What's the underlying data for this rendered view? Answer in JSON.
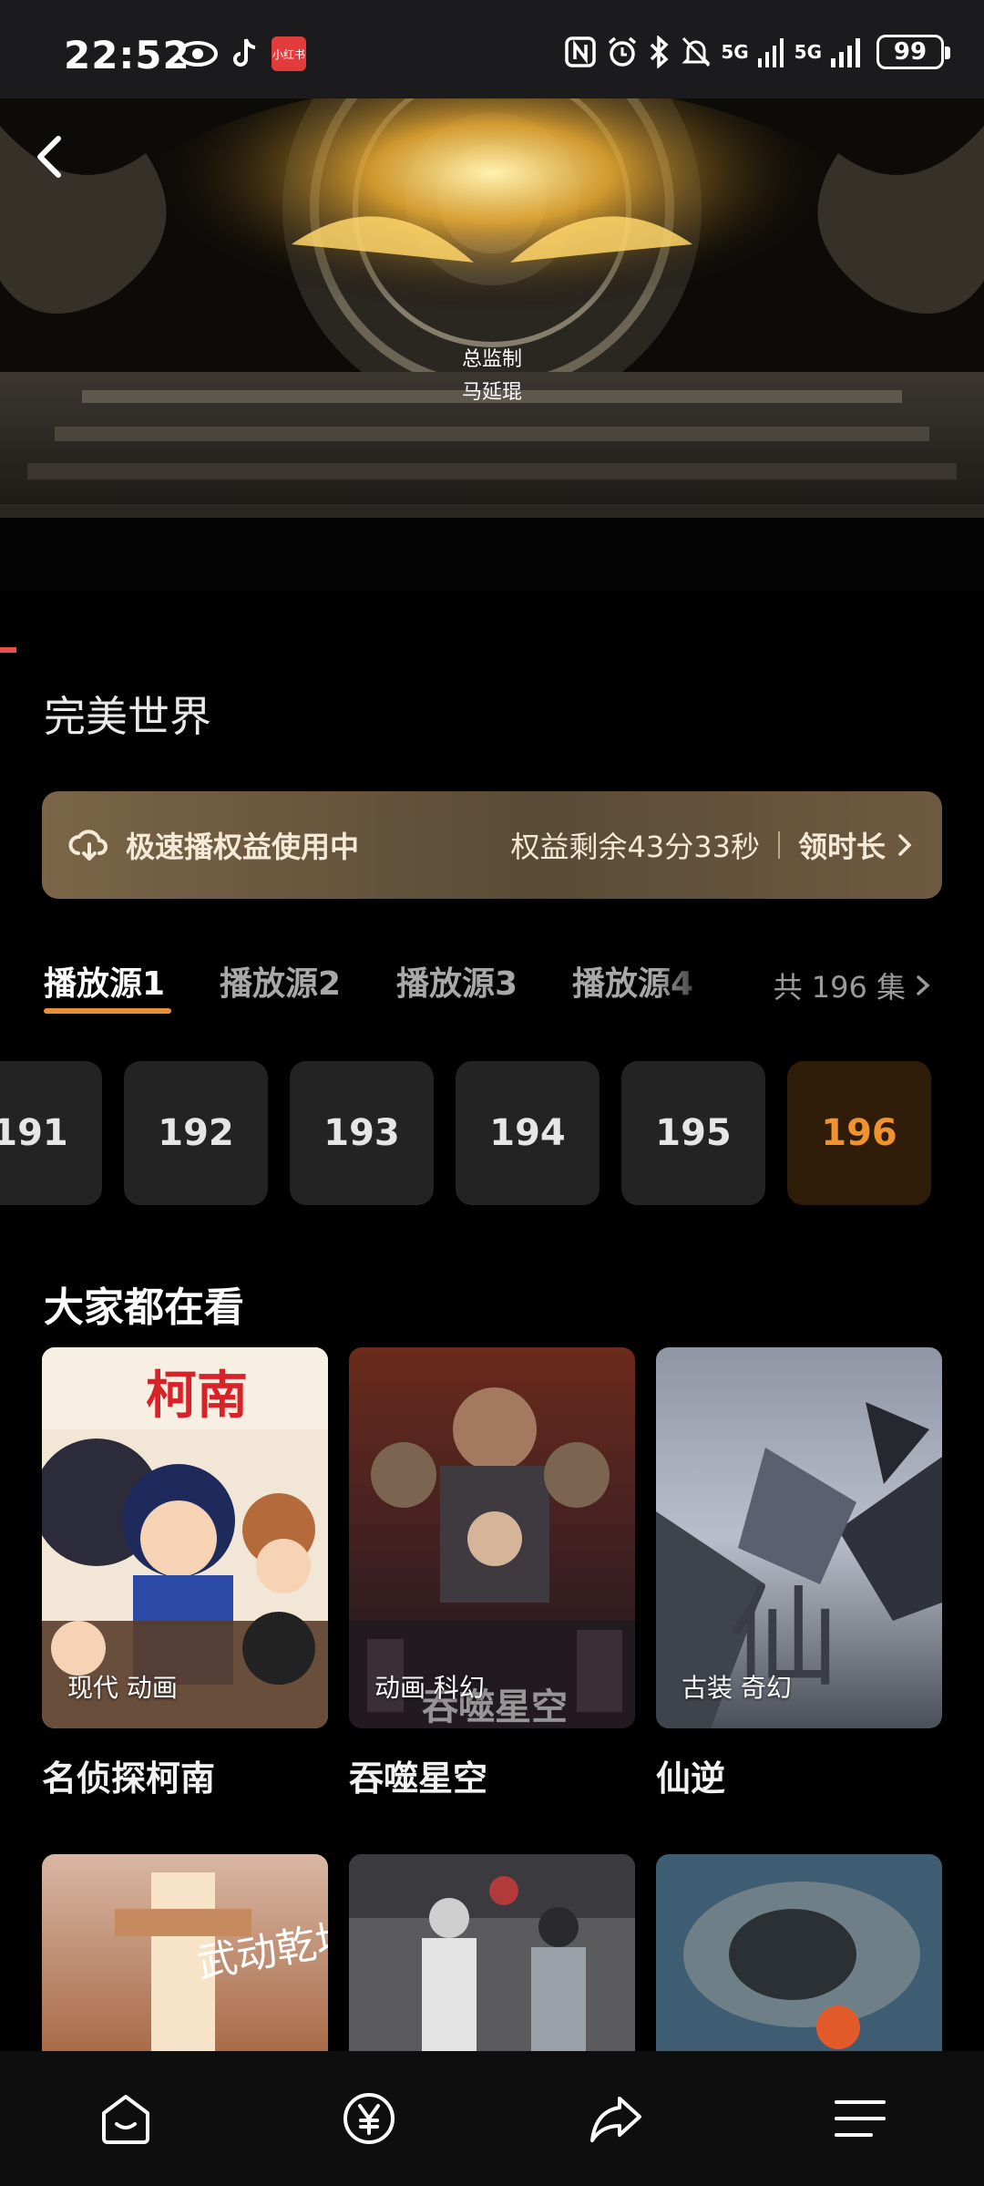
{
  "status_bar": {
    "time": "22:52",
    "red_app_label": "小红书",
    "net1": "5G",
    "net2": "5G",
    "battery": "99",
    "icons": [
      "eye-icon",
      "tiktok-icon",
      "nfc-icon",
      "alarm-icon",
      "bluetooth-icon",
      "mute-icon",
      "signal-icon"
    ]
  },
  "hero": {
    "caption_line1": "总监制",
    "caption_line2": "马延琨"
  },
  "show": {
    "title": "完美世界"
  },
  "promo": {
    "status": "极速播权益使用中",
    "remaining": "权益剩余43分33秒",
    "cta": "领时长"
  },
  "sources": {
    "tabs": [
      "播放源1",
      "播放源2",
      "播放源3",
      "播放源4"
    ],
    "active_index": 0,
    "total": "共 196 集"
  },
  "episodes": {
    "items": [
      "191",
      "192",
      "193",
      "194",
      "195",
      "196"
    ],
    "active": "196"
  },
  "recommend": {
    "section_title": "大家都在看",
    "cards": [
      {
        "title": "名侦探柯南",
        "tags": "现代 动画",
        "poster_text": "柯南"
      },
      {
        "title": "吞噬星空",
        "tags": "动画 科幻",
        "poster_text": "吞噬星空"
      },
      {
        "title": "仙逆",
        "tags": "古装 奇幻",
        "poster_text": "仙"
      }
    ],
    "row2_poster_text": "武动乾坤"
  },
  "bottom_nav": {
    "items": [
      "home-icon",
      "yen-icon",
      "share-icon",
      "menu-icon"
    ]
  },
  "colors": {
    "accent": "#f0932f",
    "promo_bg": "#6e5a40",
    "progress_red": "#e8504f"
  }
}
